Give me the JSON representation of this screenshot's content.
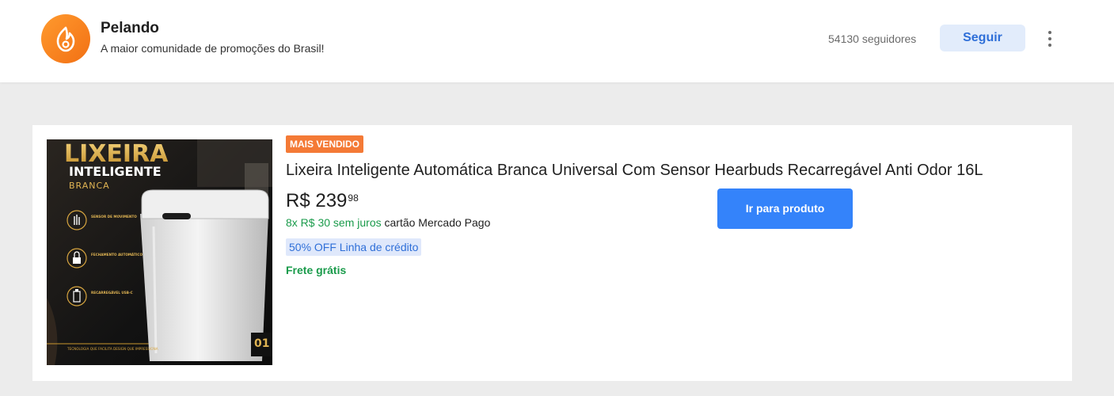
{
  "store": {
    "name": "Pelando",
    "tagline": "A maior comunidade de promoções do Brasil!",
    "followers": "54130 seguidores",
    "follow_label": "Seguir"
  },
  "product": {
    "badge": "MAIS VENDIDO",
    "title": "Lixeira Inteligente Automática Branca Universal Com Sensor Hearbuds Recarregável Anti Odor 16L",
    "price_main": "R$ 239",
    "price_cents": "98",
    "installments_green": "8x R$ 30 sem juros",
    "installments_rest": "cartão Mercado Pago",
    "credit_tag": "50% OFF Linha de crédito",
    "shipping": "Frete grátis",
    "cta_label": "Ir para produto",
    "image": {
      "headline_1": "LIXEIRA",
      "headline_2": "INTELIGENTE",
      "headline_3": "BRANCA",
      "features": [
        {
          "title": "SENSOR DE MOVIMENTO",
          "icon": "hand-icon"
        },
        {
          "title": "FECHAMENTO AUTOMÁTICO",
          "icon": "lock-icon"
        },
        {
          "title": "RECARREGÁVEL USB-C",
          "icon": "battery-icon"
        }
      ],
      "footer": "TECNOLOGIA QUE FACILITA DESIGN QUE IMPRESSIONA",
      "number": "01"
    }
  },
  "colors": {
    "brand_orange": "#f27014",
    "badge_orange": "#f47a36",
    "cta_blue": "#3483fa",
    "success_green": "#1a9b4b",
    "follow_bg": "#e2ecfb",
    "image_gold": "#d8a640"
  }
}
